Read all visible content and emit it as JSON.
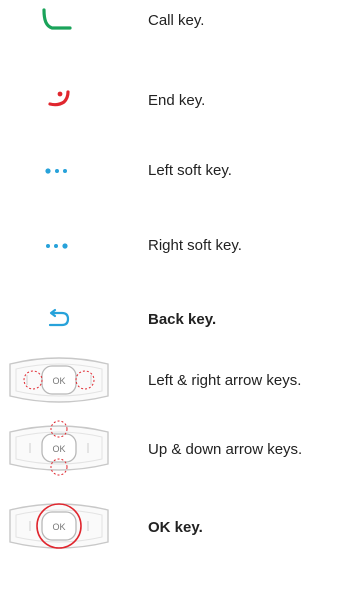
{
  "rows": [
    {
      "icon": "call-icon",
      "label": "Call key.",
      "bold": false,
      "color": "#1aa35a"
    },
    {
      "icon": "end-call-icon",
      "label": "End key.",
      "bold": false,
      "color": "#e0262e"
    },
    {
      "icon": "left-soft-key-icon",
      "label": "Left soft key.",
      "bold": false,
      "color": "#27a2da"
    },
    {
      "icon": "right-soft-key-icon",
      "label": "Right soft key.",
      "bold": false,
      "color": "#27a2da"
    },
    {
      "icon": "back-arrow-icon",
      "label": "Back key.",
      "bold": true,
      "color": "#27a2da"
    },
    {
      "icon": "navigation-pad-left-right-icon",
      "label": "Left & right arrow keys.",
      "bold": false,
      "color": "#e0262e"
    },
    {
      "icon": "navigation-pad-up-down-icon",
      "label": "Up & down arrow keys.",
      "bold": false,
      "color": "#e0262e"
    },
    {
      "icon": "navigation-pad-ok-icon",
      "label": "OK key.",
      "bold": true,
      "color": "#e0262e"
    }
  ],
  "pad": {
    "ok_text": "OK"
  }
}
